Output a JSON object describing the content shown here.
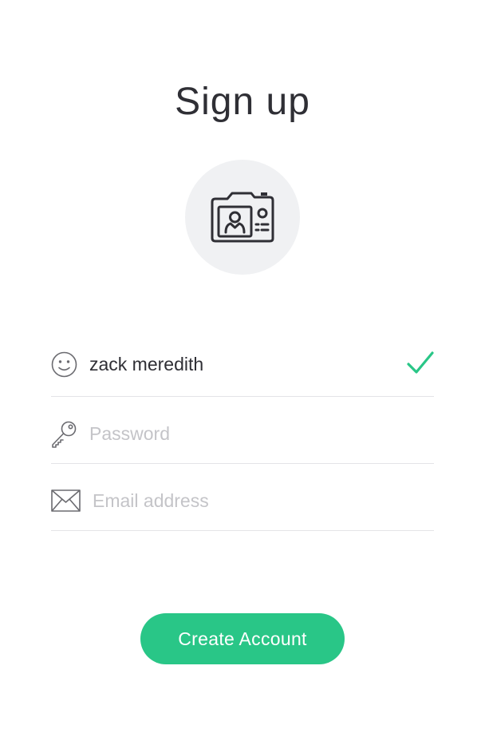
{
  "header": {
    "title": "Sign up"
  },
  "avatar": {
    "icon": "camera-id-icon",
    "background_color": "#f0f1f3"
  },
  "form": {
    "username": {
      "icon": "smiley-icon",
      "value": "zack meredith",
      "placeholder": "",
      "valid": true,
      "status_icon": "checkmark-icon",
      "status_color": "#29c687"
    },
    "password": {
      "icon": "key-icon",
      "value": "",
      "placeholder": "Password"
    },
    "email": {
      "icon": "envelope-icon",
      "value": "",
      "placeholder": "Email address"
    }
  },
  "actions": {
    "create_label": "Create Account",
    "create_color": "#29c687"
  }
}
